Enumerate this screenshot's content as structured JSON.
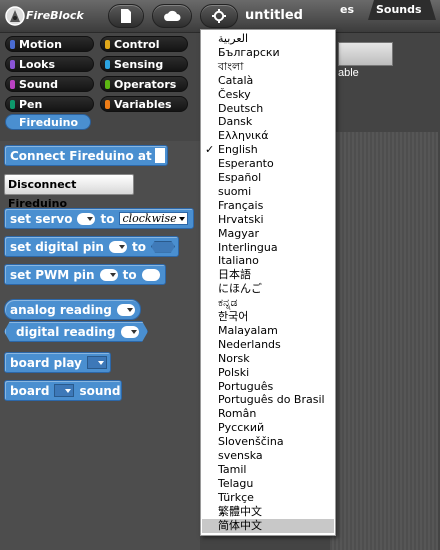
{
  "app": {
    "name": "FireBlock",
    "project_title": "untitled"
  },
  "toolbar": {
    "icons": [
      "file-icon",
      "cloud-icon",
      "settings-icon"
    ]
  },
  "categories": [
    {
      "label": "Motion",
      "color": "#4a6cd4"
    },
    {
      "label": "Control",
      "color": "#e1a91a"
    },
    {
      "label": "Looks",
      "color": "#8a55d7"
    },
    {
      "label": "Sensing",
      "color": "#2ca5e2"
    },
    {
      "label": "Sound",
      "color": "#bb42c3"
    },
    {
      "label": "Operators",
      "color": "#5cb712"
    },
    {
      "label": "Pen",
      "color": "#0e9a6c"
    },
    {
      "label": "Variables",
      "color": "#ee7d16"
    },
    {
      "label": "Fireduino",
      "color": "#4a8fd0",
      "selected": true
    }
  ],
  "palette": {
    "connect": "Connect Fireduino at",
    "disconnect": "Disconnect Fireduino",
    "set_servo": "set servo",
    "to": "to",
    "servo_direction": "clockwise",
    "set_digital_pin": "set digital pin",
    "set_pwm_pin": "set PWM pin",
    "analog_reading": "analog reading",
    "digital_reading": "digital reading",
    "board_play": "board play",
    "board": "board",
    "sound": "sound"
  },
  "stage": {
    "label_fragment": "able",
    "tab_partial": "es",
    "tab_sounds": "Sounds"
  },
  "language_menu": {
    "selected": "English",
    "highlighted": "简体中文",
    "check_mark": "✓",
    "items": [
      "العربية",
      "Български",
      "বাংলা",
      "Català",
      "Česky",
      "Deutsch",
      "Dansk",
      "Ελληνικά",
      "English",
      "Esperanto",
      "Español",
      "suomi",
      "Français",
      "Hrvatski",
      "Magyar",
      "Interlingua",
      "Italiano",
      "日本語",
      "にほんご",
      "ಕನ್ನಡ",
      "한국어",
      "Malayalam",
      "Nederlands",
      "Norsk",
      "Polski",
      "Português",
      "Português do Brasil",
      "Român",
      "Русский",
      "Slovenščina",
      "svenska",
      "Tamil",
      "Telagu",
      "Türkçe",
      "繁體中文",
      "简体中文"
    ]
  }
}
